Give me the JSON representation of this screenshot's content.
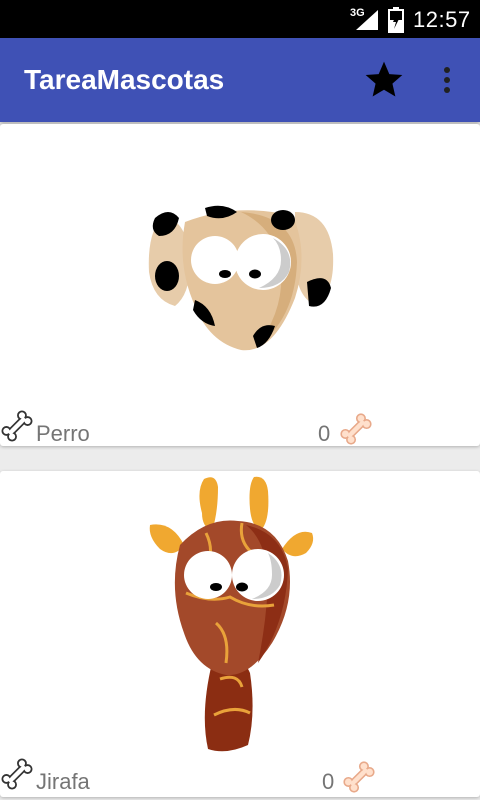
{
  "status_bar": {
    "network": "3G",
    "time": "12:57"
  },
  "app_bar": {
    "title": "TareaMascotas",
    "star_icon": "star-icon",
    "overflow_icon": "more-vert-icon",
    "color": "#3f51b5"
  },
  "pets": [
    {
      "name": "Perro",
      "ratings": "0",
      "image": "dog-face"
    },
    {
      "name": "Jirafa",
      "ratings": "0",
      "image": "giraffe-face"
    }
  ]
}
